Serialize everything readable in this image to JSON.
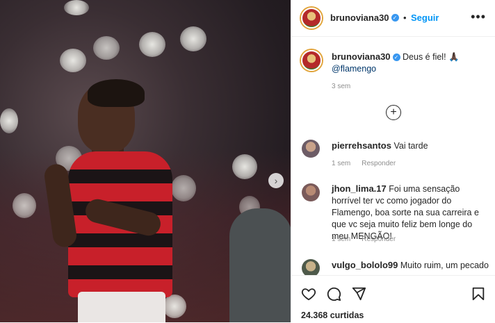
{
  "post": {
    "author": "brunoviana30",
    "follow_label": "Seguir",
    "more_label": "•••",
    "nav_arrow": "›",
    "caption_author": "brunoviana30",
    "caption_text": "Deus é fiel! 🙏🏿",
    "caption_mention": "@flamengo",
    "caption_time": "3 sem",
    "load_more": "+"
  },
  "comments": [
    {
      "user": "pierrehsantos",
      "text": "Vai tarde",
      "time": "1 sem",
      "reply": "Responder"
    },
    {
      "user": "jhon_lima.17",
      "text": "Foi uma sensação horrível ter vc como jogador do Flamengo, boa sorte na sua carreira e que vc seja muito feliz bem longe do meu MENGÃO!",
      "time": "1 sem",
      "reply": "Responder"
    },
    {
      "user": "vulgo_bololo99",
      "text": "Muito ruim, um pecado",
      "time": "",
      "reply": ""
    }
  ],
  "footer": {
    "likes_count": "24.368",
    "likes_label": "curtidas"
  },
  "icons": [
    "heart-icon",
    "comment-icon",
    "share-icon",
    "bookmark-icon",
    "verified-icon",
    "plus-circle-icon",
    "more-icon",
    "next-arrow-icon"
  ],
  "colors": {
    "link": "#0095f6",
    "verified": "#3897f0",
    "jersey_red": "#c8202a",
    "jersey_black": "#1b1416"
  }
}
